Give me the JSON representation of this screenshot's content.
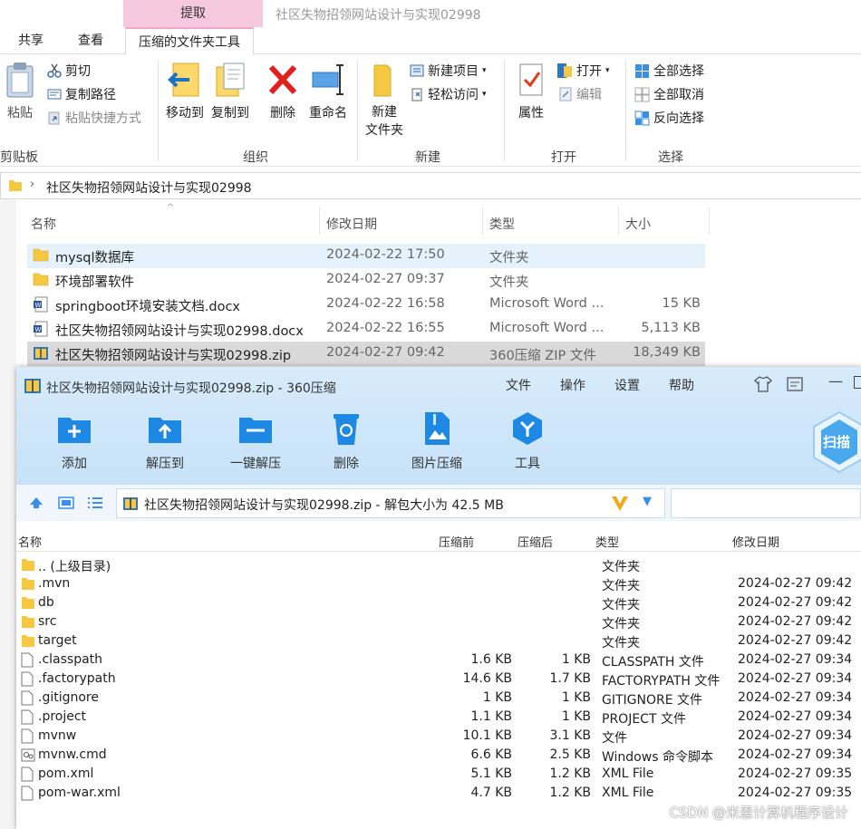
{
  "explorer": {
    "context_tab_head": "提取",
    "title": "社区失物招领网站设计与实现02998",
    "tabs": [
      "共享",
      "查看",
      "压缩的文件夹工具"
    ],
    "ribbon": {
      "clipboard": {
        "label": "剪贴板",
        "paste": "粘贴",
        "cut": "剪切",
        "copy_path": "复制路径",
        "paste_shortcut": "粘贴快捷方式"
      },
      "organize": {
        "label": "组织",
        "move_to": "移动到",
        "copy_to": "复制到",
        "delete": "删除",
        "rename": "重命名"
      },
      "new": {
        "label": "新建",
        "new_folder_line1": "新建",
        "new_folder_line2": "文件夹",
        "new_item": "新建项目",
        "easy_access": "轻松访问"
      },
      "open": {
        "label": "打开",
        "properties": "属性",
        "open": "打开",
        "edit": "编辑"
      },
      "select": {
        "label": "选择",
        "select_all": "全部选择",
        "select_none": "全部取消",
        "invert": "反向选择"
      }
    },
    "address": "社区失物招领网站设计与实现02998",
    "columns": {
      "name": "名称",
      "date": "修改日期",
      "type": "类型",
      "size": "大小"
    },
    "files": [
      {
        "name": "mysql数据库",
        "date": "2024-02-22 17:50",
        "type": "文件夹",
        "size": "",
        "icon": "folder-icon"
      },
      {
        "name": "环境部署软件",
        "date": "2024-02-27 09:37",
        "type": "文件夹",
        "size": "",
        "icon": "folder-icon"
      },
      {
        "name": "springboot环境安装文档.docx",
        "date": "2024-02-22 16:58",
        "type": "Microsoft Word ...",
        "size": "15 KB",
        "icon": "word-doc-icon"
      },
      {
        "name": "社区失物招领网站设计与实现02998.docx",
        "date": "2024-02-22 16:55",
        "type": "Microsoft Word ...",
        "size": "5,113 KB",
        "icon": "word-doc-icon"
      },
      {
        "name": "社区失物招领网站设计与实现02998.zip",
        "date": "2024-02-27 09:42",
        "type": "360压缩 ZIP 文件",
        "size": "18,349 KB",
        "icon": "zip-archive-icon"
      }
    ]
  },
  "zip": {
    "title": "社区失物招领网站设计与实现02998.zip - 360压缩",
    "menu": [
      "文件",
      "操作",
      "设置",
      "帮助"
    ],
    "tools": [
      "添加",
      "解压到",
      "一键解压",
      "删除",
      "图片压缩",
      "工具"
    ],
    "scan": "扫描",
    "path": "社区失物招领网站设计与实现02998.zip - 解包大小为 42.5 MB",
    "columns": {
      "name": "名称",
      "before": "压缩前",
      "after": "压缩后",
      "type": "类型",
      "date": "修改日期"
    },
    "rows": [
      {
        "name": ".. (上级目录)",
        "before": "",
        "after": "",
        "type": "文件夹",
        "date": "",
        "icon": "folder-icon"
      },
      {
        "name": ".mvn",
        "before": "",
        "after": "",
        "type": "文件夹",
        "date": "2024-02-27 09:42",
        "icon": "folder-icon"
      },
      {
        "name": "db",
        "before": "",
        "after": "",
        "type": "文件夹",
        "date": "2024-02-27 09:42",
        "icon": "folder-icon"
      },
      {
        "name": "src",
        "before": "",
        "after": "",
        "type": "文件夹",
        "date": "2024-02-27 09:42",
        "icon": "folder-icon"
      },
      {
        "name": "target",
        "before": "",
        "after": "",
        "type": "文件夹",
        "date": "2024-02-27 09:42",
        "icon": "folder-icon"
      },
      {
        "name": ".classpath",
        "before": "1.6 KB",
        "after": "1 KB",
        "type": "CLASSPATH 文件",
        "date": "2024-02-27 09:34",
        "icon": "file-icon"
      },
      {
        "name": ".factorypath",
        "before": "14.6 KB",
        "after": "1.7 KB",
        "type": "FACTORYPATH 文件",
        "date": "2024-02-27 09:34",
        "icon": "file-icon"
      },
      {
        "name": ".gitignore",
        "before": "1 KB",
        "after": "1 KB",
        "type": "GITIGNORE 文件",
        "date": "2024-02-27 09:34",
        "icon": "file-icon"
      },
      {
        "name": ".project",
        "before": "1.1 KB",
        "after": "1 KB",
        "type": "PROJECT 文件",
        "date": "2024-02-27 09:34",
        "icon": "file-icon"
      },
      {
        "name": "mvnw",
        "before": "10.1 KB",
        "after": "3.1 KB",
        "type": "文件",
        "date": "2024-02-27 09:34",
        "icon": "file-icon"
      },
      {
        "name": "mvnw.cmd",
        "before": "6.6 KB",
        "after": "2.5 KB",
        "type": "Windows 命令脚本",
        "date": "2024-02-27 09:34",
        "icon": "cmd-script-icon"
      },
      {
        "name": "pom.xml",
        "before": "5.1 KB",
        "after": "1.2 KB",
        "type": "XML File",
        "date": "2024-02-27 09:35",
        "icon": "file-icon"
      },
      {
        "name": "pom-war.xml",
        "before": "4.7 KB",
        "after": "1.2 KB",
        "type": "XML File",
        "date": "2024-02-27 09:35",
        "icon": "file-icon"
      }
    ]
  },
  "watermark": "CSDN @米恩计算机程序设计",
  "colors": {
    "context_tab": "#f6c8e0",
    "zip_header": "#cfe6fa",
    "selection": "#e5f1fb",
    "folder": "#f5c842",
    "accent_blue": "#1e88e5"
  }
}
